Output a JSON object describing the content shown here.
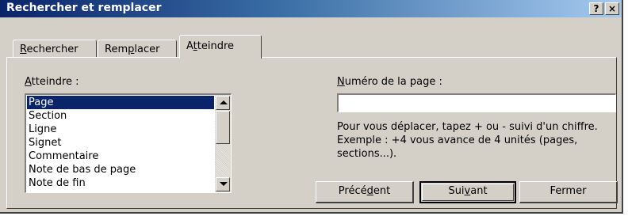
{
  "window": {
    "title": "Rechercher et remplacer",
    "help_button": "?",
    "close_button": "×"
  },
  "tabs": [
    {
      "label": "Rechercher",
      "accesskey": "R"
    },
    {
      "label": "Remplacer",
      "accesskey": "p"
    },
    {
      "label": "Atteindre",
      "accesskey": "t",
      "active": true
    }
  ],
  "goto_section": {
    "label": "Atteindre :",
    "items": [
      "Page",
      "Section",
      "Ligne",
      "Signet",
      "Commentaire",
      "Note de bas de page",
      "Note de fin"
    ],
    "selected": "Page"
  },
  "page_number": {
    "label": "Numéro de la page :",
    "value": "",
    "help": "Pour vous déplacer, tapez + ou - suivi d'un chiffre. Exemple : +4 vous avance de 4 unités (pages, sections...)."
  },
  "buttons": {
    "previous": "Précédent",
    "next": "Suivant",
    "close": "Fermer"
  }
}
